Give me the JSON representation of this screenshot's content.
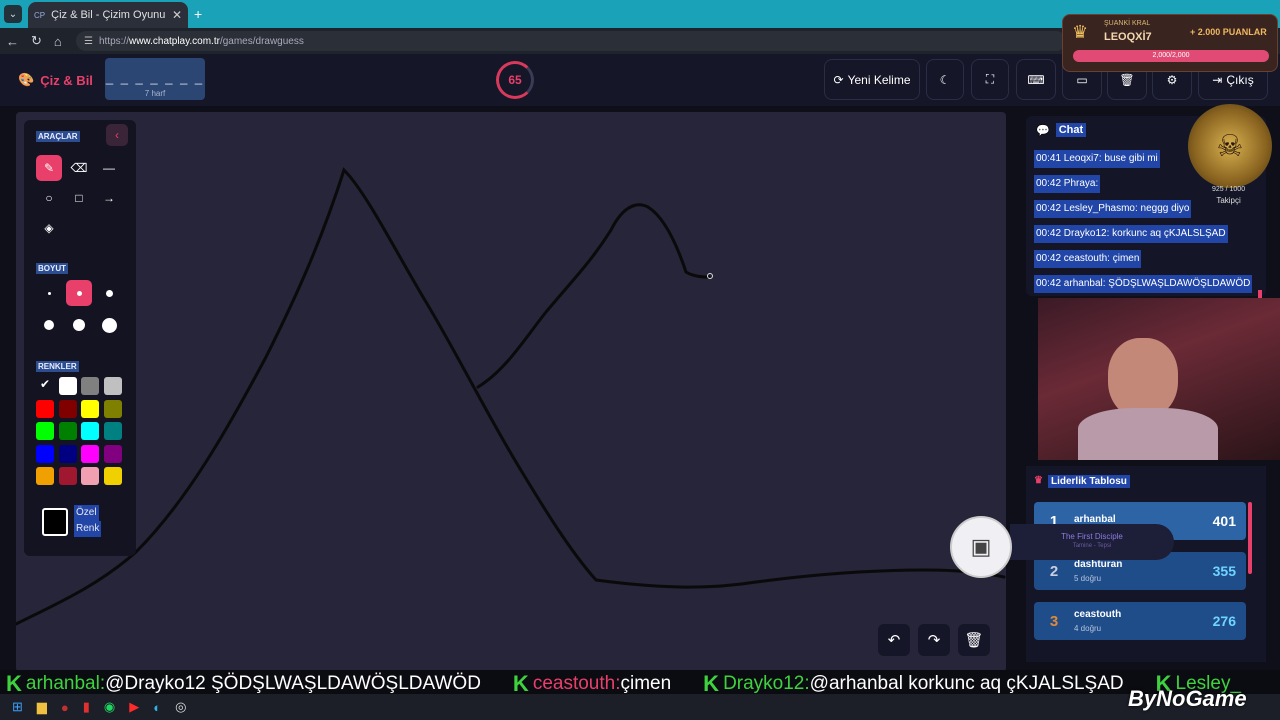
{
  "browser": {
    "tab_title": "Çiz & Bil - Çizim Oyunu",
    "tab_favicon": "CP",
    "url_domain": "www.chatplay.com.tr",
    "url_path": "/games/drawguess",
    "url_scheme": "https://"
  },
  "header": {
    "app_name": "Çiz & Bil",
    "word_mask": "_ _ _ _ _ _ _",
    "word_hint": "7 harf",
    "timer": "65",
    "timer_progress": 0.72,
    "new_word_label": "Yeni Kelime",
    "exit_label": "Çıkış"
  },
  "tools": {
    "section_tools": "ARAÇLAR",
    "section_size": "BOYUT",
    "section_colors": "RENKLER",
    "custom_color_line1": "Özel",
    "custom_color_line2": "Renk",
    "selected_tool": "pen",
    "selected_size": 2,
    "selected_color": "#000000",
    "colors": [
      "#000000",
      "#ffffff",
      "#808080",
      "#c0c0c0",
      "#ff0000",
      "#800000",
      "#ffff00",
      "#808000",
      "#00ff00",
      "#008000",
      "#00ffff",
      "#008080",
      "#0000ff",
      "#000080",
      "#ff00ff",
      "#800080",
      "#f0a000",
      "#a01830",
      "#f0a0b0",
      "#f0d000"
    ]
  },
  "chat": {
    "title": "Chat",
    "messages": [
      {
        "time": "00:41",
        "user": "Leoqxi7",
        "text": "buse gibi mi"
      },
      {
        "time": "00:42",
        "user": "Phraya",
        "text": ""
      },
      {
        "time": "00:42",
        "user": "Lesley_Phasmo",
        "text": "neggg diyo"
      },
      {
        "time": "00:42",
        "user": "Drayko12",
        "text": "korkunc aq çKJALSLŞAD"
      },
      {
        "time": "00:42",
        "user": "ceastouth",
        "text": "çimen"
      },
      {
        "time": "00:42",
        "user": "arhanbal",
        "text": "ŞÖDŞLWAŞLDAWÖŞLDAWÖD"
      }
    ]
  },
  "leaderboard": {
    "title": "Liderlik Tablosu",
    "rows": [
      {
        "rank": "1",
        "name": "arhanbal",
        "sub": "",
        "score": "401"
      },
      {
        "rank": "2",
        "name": "dashturan",
        "sub": "5 doğru",
        "score": "355"
      },
      {
        "rank": "3",
        "name": "ceastouth",
        "sub": "4 doğru",
        "score": "276"
      }
    ]
  },
  "overlay": {
    "king_label": "ŞUANKİ KRAL",
    "king_name": "LEOQXİ7",
    "king_points": "+ 2.000 PUANLAR",
    "king_bar": "2,000/2,000",
    "followers": "925 / 1000",
    "followers_label": "Takipçi",
    "disciple_title": "The First Disciple",
    "disciple_sub": "Tamine - Tepsi",
    "watermark": "ByNoGame"
  },
  "ticker": [
    {
      "user": "arhanbal:",
      "text": "@Drayko12 ŞÖDŞLWAŞLDAWÖŞLDAWÖD"
    },
    {
      "user": "ceastouth:",
      "text": "çimen"
    },
    {
      "user": "Drayko12:",
      "text": "@arhanbal korkunc aq çKJALSLŞAD"
    },
    {
      "user": "Lesley_",
      "text": ""
    }
  ],
  "colors": {
    "accent": "#e8406a",
    "panel": "#141628",
    "board": "#262539",
    "highlight": "#2146a8"
  }
}
